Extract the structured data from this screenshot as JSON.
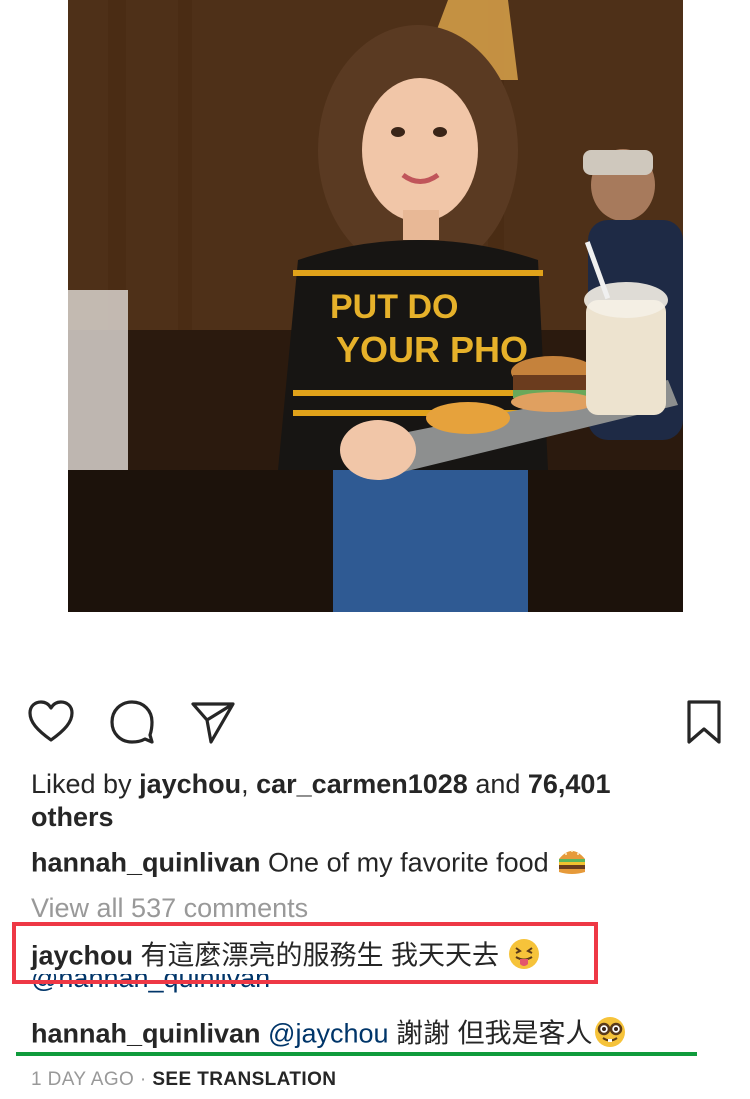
{
  "post": {
    "liked_by_prefix": "Liked by ",
    "liker1": "jaychou",
    "sep": ", ",
    "liker2": "car_carmen1028",
    "and": " and ",
    "others_count": "76,401",
    "others": "others",
    "caption_user": "hannah_quinlivan",
    "caption_text": " One of my favorite food",
    "view_all": "View all 537 comments",
    "comment1_user": "jaychou",
    "comment1_text": " 有這麼漂亮的服務生 我天天去",
    "comment1_reply_tag": "@hannah_quinlivan",
    "comment2_user": "hannah_quinlivan",
    "comment2_mention": " @jaychou",
    "comment2_text": " 謝謝 但我是客人",
    "time_ago": "1 DAY AGO",
    "dot": " · ",
    "see_translation": "SEE TRANSLATION"
  },
  "photo": {
    "shirt_line1": "PUT DO",
    "shirt_line2": "YOUR PHO"
  },
  "icons": {
    "like": "heart-icon",
    "comment": "comment-icon",
    "share": "send-icon",
    "save": "bookmark-icon"
  },
  "colors": {
    "highlight_box": "#ee3845",
    "underline": "#0f9b3c",
    "mention": "#003569",
    "muted": "#999999"
  }
}
